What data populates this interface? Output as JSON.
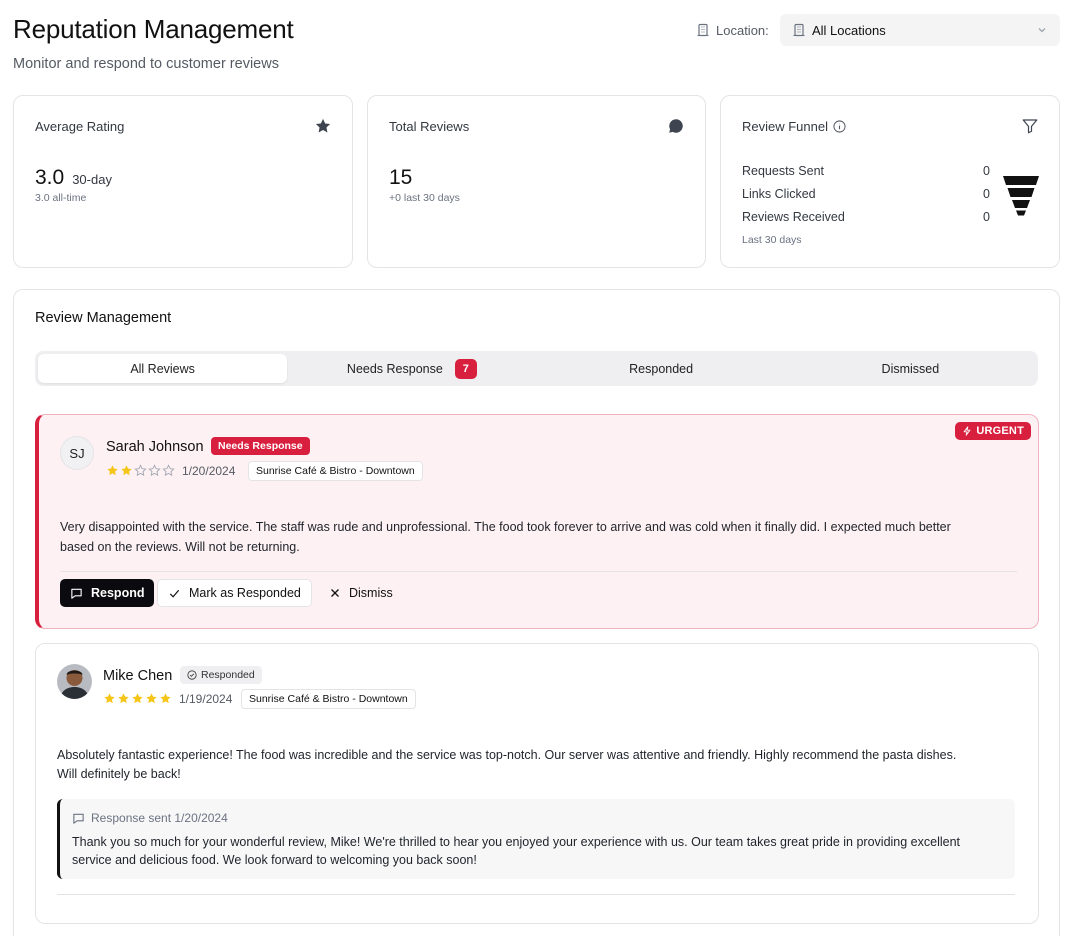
{
  "header": {
    "title": "Reputation Management",
    "subtitle": "Monitor and respond to customer reviews",
    "location_label": "Location:",
    "location_value": "All Locations"
  },
  "stats": {
    "average_rating": {
      "title": "Average Rating",
      "value": "3.0",
      "period": "30-day",
      "alltime": "3.0 all-time"
    },
    "total_reviews": {
      "title": "Total Reviews",
      "value": "15",
      "change": "+0 last 30 days"
    },
    "funnel": {
      "title": "Review Funnel",
      "rows": [
        {
          "label": "Requests Sent",
          "value": "0"
        },
        {
          "label": "Links Clicked",
          "value": "0"
        },
        {
          "label": "Reviews Received",
          "value": "0"
        }
      ],
      "footer": "Last 30 days"
    }
  },
  "management": {
    "title": "Review Management",
    "tabs": [
      {
        "label": "All Reviews",
        "active": true
      },
      {
        "label": "Needs Response",
        "badge": "7"
      },
      {
        "label": "Responded"
      },
      {
        "label": "Dismissed"
      }
    ]
  },
  "reviews": [
    {
      "initials": "SJ",
      "name": "Sarah Johnson",
      "status": "Needs Response",
      "urgent_label": "URGENT",
      "rating": 2,
      "date": "1/20/2024",
      "location": "Sunrise Café & Bistro - Downtown",
      "text_line1": "Very disappointed with the service. The staff was rude and unprofessional. The food took forever to arrive and was cold when it finally did. I expected much better",
      "text_line2": "based on the reviews. Will not be returning.",
      "actions": {
        "respond": "Respond",
        "mark": "Mark as Responded",
        "dismiss": "Dismiss"
      }
    },
    {
      "name": "Mike Chen",
      "status": "Responded",
      "rating": 5,
      "date": "1/19/2024",
      "location": "Sunrise Café & Bistro - Downtown",
      "text_line1": "Absolutely fantastic experience! The food was incredible and the service was top-notch. Our server was attentive and friendly. Highly recommend the pasta dishes.",
      "text_line2": "Will definitely be back!",
      "response": {
        "header": "Response sent 1/20/2024",
        "line1": "Thank you so much for your wonderful review, Mike! We're thrilled to hear you enjoyed your experience with us. Our team takes great pride in providing excellent",
        "line2": "service and delicious food. We look forward to welcoming you back soon!"
      }
    }
  ],
  "colors": {
    "accent": "#d81f3e",
    "star": "#f5c518",
    "dark": "#0b0b0f"
  }
}
